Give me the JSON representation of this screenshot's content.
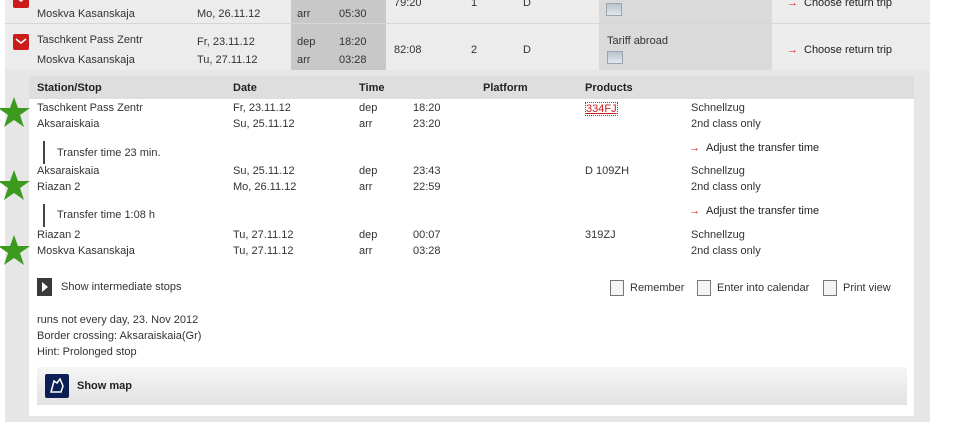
{
  "summary": {
    "prev_row": {
      "destination": "Moskva Kasanskaja",
      "arrival_date": "Mo, 26.11.12",
      "arrival_type": "arr",
      "arrival_time": "05:30",
      "duration": "79:20",
      "changes": "1",
      "products": "D",
      "return_label": "Choose return trip"
    },
    "main_row": {
      "origin": "Taschkent Pass Zentr",
      "destination": "Moskva Kasanskaja",
      "dep_date": "Fr, 23.11.12",
      "arr_date": "Tu, 27.11.12",
      "dep_type": "dep",
      "arr_type": "arr",
      "dep_time": "18:20",
      "arr_time": "03:28",
      "duration": "82:08",
      "changes": "2",
      "products": "D",
      "tariff": "Tariff abroad",
      "return_label": "Choose return trip"
    }
  },
  "details": {
    "headers": {
      "station": "Station/Stop",
      "date": "Date",
      "time": "Time",
      "platform": "Platform",
      "products": "Products"
    },
    "legs": [
      {
        "from": "Taschkent Pass Zentr",
        "to": "Aksaraiskaia",
        "dep_date": "Fr, 23.11.12",
        "arr_date": "Su, 25.11.12",
        "dep_type": "dep",
        "arr_type": "arr",
        "dep_time": "18:20",
        "arr_time": "23:20",
        "product": "334FJ",
        "product_name": "Schnellzug",
        "product_class": "2nd class only"
      },
      {
        "from": "Aksaraiskaia",
        "to": "Riazan 2",
        "dep_date": "Su, 25.11.12",
        "arr_date": "Mo, 26.11.12",
        "dep_type": "dep",
        "arr_type": "arr",
        "dep_time": "23:43",
        "arr_time": "22:59",
        "product": "D 109ZH",
        "product_name": "Schnellzug",
        "product_class": "2nd class only"
      },
      {
        "from": "Riazan 2",
        "to": "Moskva Kasanskaja",
        "dep_date": "Tu, 27.11.12",
        "arr_date": "Tu, 27.11.12",
        "dep_type": "dep",
        "arr_type": "arr",
        "dep_time": "00:07",
        "arr_time": "03:28",
        "product": "319ZJ",
        "product_name": "Schnellzug",
        "product_class": "2nd class only"
      }
    ],
    "transfers": [
      {
        "label": "Transfer time 23 min.",
        "action": "Adjust the transfer time"
      },
      {
        "label": "Transfer time 1:08 h",
        "action": "Adjust the transfer time"
      }
    ],
    "show_intermediate": "Show intermediate stops",
    "actions": {
      "remember": "Remember",
      "calendar": "Enter into calendar",
      "print": "Print view"
    },
    "notes": [
      "runs not every day, 23. Nov 2012",
      "Border crossing: Aksaraiskaia(Gr)",
      "Hint: Prolonged stop"
    ],
    "show_map": "Show map"
  },
  "colors": {
    "accent_red": "#cc1b1b",
    "star_green": "#3c9a1f",
    "map_icon_navy": "#0b1f52"
  }
}
